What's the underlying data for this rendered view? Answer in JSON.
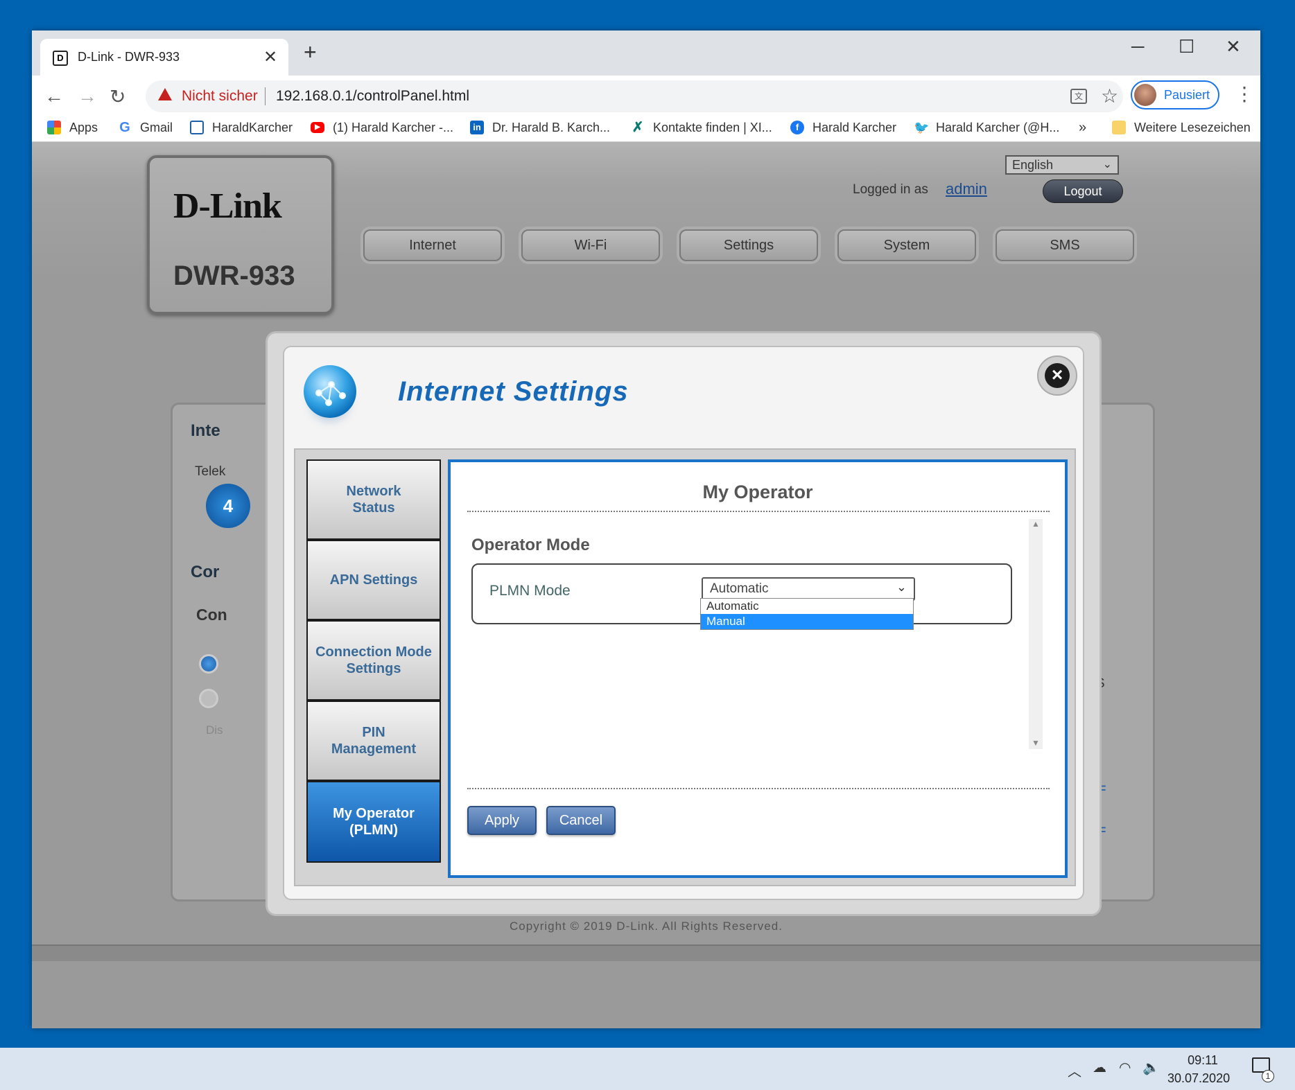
{
  "browser": {
    "tab_title": "D-Link - DWR-933",
    "tab_favicon": "D",
    "url_warning": "Nicht sicher",
    "url": "192.168.0.1/controlPanel.html",
    "profile_label": "Pausiert",
    "bookmarks": [
      {
        "label": "Apps",
        "icon": "apps-grid-icon"
      },
      {
        "label": "Gmail",
        "icon": "google-icon"
      },
      {
        "label": "HaraldKarcher",
        "icon": "page-icon"
      },
      {
        "label": "(1) Harald Karcher -...",
        "icon": "youtube-icon"
      },
      {
        "label": "Dr. Harald B. Karch...",
        "icon": "linkedin-icon"
      },
      {
        "label": "Kontakte finden | XI...",
        "icon": "xing-icon"
      },
      {
        "label": "Harald Karcher",
        "icon": "facebook-icon"
      },
      {
        "label": "Harald Karcher (@H...",
        "icon": "twitter-icon"
      }
    ],
    "bookmarks_overflow": "»",
    "other_bookmarks": "Weitere Lesezeichen"
  },
  "router": {
    "brand": "D-Link",
    "model": "DWR-933",
    "language": "English",
    "logged_in_as": "Logged in as",
    "user": "admin",
    "logout": "Logout",
    "menu": [
      "Internet",
      "Wi-Fi",
      "Settings",
      "System",
      "SMS"
    ],
    "bg_fragments": {
      "inte": "Inte",
      "telek": "Telek",
      "cor": "Cor",
      "con": "Con",
      "dis": "Dis",
      "ms": "MS",
      "f1": "F",
      "f2": "F",
      "num": "4"
    },
    "copyright": "Copyright © 2019 D-Link. All Rights Reserved."
  },
  "modal": {
    "title": "Internet Settings",
    "sidebar": [
      {
        "label": "Network Status",
        "active": false
      },
      {
        "label": "APN Settings",
        "active": false
      },
      {
        "label": "Connection Mode Settings",
        "active": false
      },
      {
        "label": "PIN Management",
        "active": false
      },
      {
        "label": "My Operator (PLMN)",
        "active": true
      }
    ],
    "content_title": "My Operator",
    "section_title": "Operator Mode",
    "field_label": "PLMN Mode",
    "select_value": "Automatic",
    "options": [
      "Automatic",
      "Manual"
    ],
    "highlighted_option": "Manual",
    "apply": "Apply",
    "cancel": "Cancel"
  },
  "taskbar": {
    "time": "09:11",
    "date": "30.07.2020",
    "notification_count": "1"
  }
}
